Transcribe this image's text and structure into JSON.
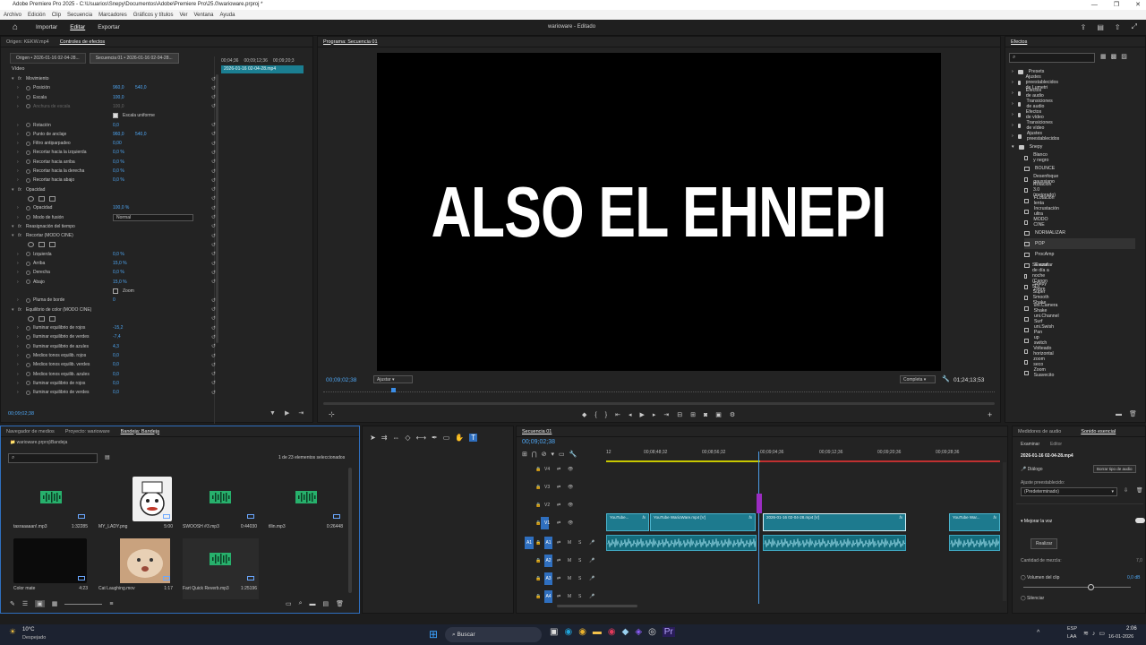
{
  "title_bar": {
    "title": "Adobe Premiere Pro 2025 - C:\\Usuarios\\Snepy\\Documentos\\Adobe\\Premiere Pro\\25.0\\warioware.prproj *",
    "controls": [
      "—",
      "❐",
      "✕"
    ]
  },
  "menu": [
    "Archivo",
    "Edición",
    "Clip",
    "Secuencia",
    "Marcadores",
    "Gráficos y títulos",
    "Ver",
    "Ventana",
    "Ayuda"
  ],
  "app_bar": {
    "workspaces": [
      "Importar",
      "Editar",
      "Exportar"
    ],
    "active": "Editar",
    "project_title": "warioware - Editado"
  },
  "effect_controls": {
    "tabs": [
      "Origen: KEKW.mp4",
      "Controles de efectos"
    ],
    "subtabs": [
      "Origen • 2026-01-16 02-04-28...",
      "Secuencia 01 • 2026-01-16 02-04-28..."
    ],
    "ruler": [
      "00;04;36",
      "00;09;12;36",
      "00;09;20;3"
    ],
    "clip_label": "2026-01-16 02-04-28.mp4",
    "video_label": "Vídeo",
    "rows": [
      {
        "label": "Movimiento",
        "type": "section",
        "fx": true
      },
      {
        "label": "Posición",
        "v1": "960,0",
        "v2": "540,0"
      },
      {
        "label": "Escala",
        "v1": "100,0"
      },
      {
        "label": "Anchura de escala",
        "v1": "100,0",
        "dim": true
      },
      {
        "label": "",
        "check": "Escala uniforme"
      },
      {
        "label": "Rotación",
        "v1": "0,0"
      },
      {
        "label": "Punto de anclaje",
        "v1": "960,0",
        "v2": "540,0"
      },
      {
        "label": "Filtro antiparpadeo",
        "v1": "0,00"
      },
      {
        "label": "Recortar hacia la izquierda",
        "v1": "0,0 %"
      },
      {
        "label": "Recortar hacia arriba",
        "v1": "0,0 %"
      },
      {
        "label": "Recortar hacia la derecha",
        "v1": "0,0 %"
      },
      {
        "label": "Recortar hacia abajo",
        "v1": "0,0 %"
      },
      {
        "label": "Opacidad",
        "type": "section",
        "fx": true
      },
      {
        "label": "",
        "shapes": true
      },
      {
        "label": "Opacidad",
        "v1": "100,0 %"
      },
      {
        "label": "Modo de fusión",
        "select": "Normal"
      },
      {
        "label": "Reasignación del tiempo",
        "type": "section",
        "fx": true
      },
      {
        "label": "Recortar (MODO CINE)",
        "type": "section",
        "fx": true
      },
      {
        "label": "",
        "shapes": true
      },
      {
        "label": "Izquierda",
        "v1": "0,0 %"
      },
      {
        "label": "Arriba",
        "v1": "15,0 %"
      },
      {
        "label": "Derecha",
        "v1": "0,0 %"
      },
      {
        "label": "Abajo",
        "v1": "15,0 %"
      },
      {
        "label": "",
        "check": "Zoom"
      },
      {
        "label": "Pluma de borde",
        "v1": "0"
      },
      {
        "label": "Equilibrio de color (MODO CINE)",
        "type": "section",
        "fx": true
      },
      {
        "label": "",
        "shapes": true
      },
      {
        "label": "Iluminar equilibrio de rojos",
        "v1": "-15,2"
      },
      {
        "label": "Iluminar equilibrio de verdes",
        "v1": "-7,4"
      },
      {
        "label": "Iluminar equilibrio de azules",
        "v1": "4,3"
      },
      {
        "label": "Medios tonos equilib. rojos",
        "v1": "0,0"
      },
      {
        "label": "Medios tonos equilib. verdes",
        "v1": "0,0"
      },
      {
        "label": "Medios tonos equilib. azules",
        "v1": "0,0"
      },
      {
        "label": "Iluminar equilibrio de rojos",
        "v1": "0,0"
      },
      {
        "label": "Iluminar equilibrio de verdes",
        "v1": "0,0"
      }
    ],
    "timecode": "00;09;02;38"
  },
  "program_monitor": {
    "tab": "Programa: Secuencia 01",
    "frame_text": "ALSO EL EHNEPI",
    "timecode": "00;09;02;38",
    "fit": "Ajustar",
    "quality": "Completa",
    "duration": "01;24;13;53"
  },
  "effects": {
    "tab": "Efectos",
    "search_placeholder": "",
    "folders": [
      "Presets",
      "Ajustes preestablecidos de Lumetri",
      "Efectos de audio",
      "Transiciones de audio",
      "Efectos de vídeo",
      "Transiciones de vídeo",
      "Ajustes preestablecidos",
      "Snepy"
    ],
    "items": [
      "Blanco y negro",
      "BOUNCE",
      "Desenfoque gaussiano",
      "Rotacion 3.0 (mejorado)",
      "FLotacion lenta",
      "Incrustación ultra",
      "MODO CINE",
      "NORMALIZAR",
      "POP",
      "ProcAmp",
      "Recortar",
      "SL azul de día a noche (Canon 5D)",
      "Snepy Zoom",
      "Super Smooth Shake",
      "uni.Camera Shake",
      "uni.Channel Surf",
      "uni.Swish Pan",
      "up switch",
      "Volteado horizontal",
      "zoom seco",
      "Zoom Suavecito"
    ]
  },
  "bin": {
    "tabs": [
      "Navegador de medios",
      "Proyecto: warioware",
      "Bandeja: Bandeja"
    ],
    "path": "warioware.prproj\\Bandeja",
    "count": "1 de 23 elementos seleccionados",
    "items": [
      {
        "name": "tasraaaaan!.mp3",
        "dur": "1:32285",
        "kind": "audio"
      },
      {
        "name": "MY_LADY.png",
        "dur": "5:00",
        "kind": "image"
      },
      {
        "name": "SWOOSH #3.mp3",
        "dur": "0:44030",
        "kind": "audio"
      },
      {
        "name": "tllin.mp3",
        "dur": "0:26448",
        "kind": "audio"
      },
      {
        "name": "Color mate",
        "dur": "4:23",
        "kind": "black"
      },
      {
        "name": "Cat Laughing.mov",
        "dur": "1:17",
        "kind": "cat"
      },
      {
        "name": "Fart Quick Reverb.mp3",
        "dur": "1:25196",
        "kind": "audio"
      }
    ]
  },
  "timeline": {
    "tab": "Secuencia 01",
    "timecode": "00;09;02;38",
    "ruler": [
      "00;08;48;32",
      "00;08;56;32",
      "00;09;04;36",
      "00;09;12;36",
      "00;09;20;36",
      "00;09;28;36",
      "12"
    ],
    "tracks_video": [
      "V4",
      "V3",
      "V2",
      "V1"
    ],
    "tracks_audio": [
      "A1",
      "A2",
      "A3",
      "A4"
    ],
    "clips": [
      "YouTube...",
      "YouTube WarioWare.mp4 [V]",
      "2026-01-16 02-04-28.mp4 [V]",
      "YouTube War..."
    ]
  },
  "essential_sound": {
    "tabs": [
      "Medidores de audio",
      "Sonido esencial"
    ],
    "subtabs": [
      "Examinar",
      "Editor"
    ],
    "clip": "2026-01-16 02-04-28.mp4",
    "type": "Diálogo",
    "clear_btn": "Borrar tipo de audio",
    "preset_label": "Ajuste preestablecido:",
    "preset": "(Predeterminado)",
    "section": "Mejorar la voz",
    "action": "Realizar",
    "mix_label": "Cantidad de mezcla:",
    "mix_value": "7,0",
    "volume_label": "Volumen del clip",
    "volume_value": "0,0 dB",
    "mute_label": "Silenciar"
  },
  "taskbar": {
    "weather_temp": "10°C",
    "weather_desc": "Despejado",
    "search": "Buscar",
    "lang1": "ESP",
    "lang2": "LAA",
    "time": "2:06",
    "date": "16-01-2026"
  }
}
